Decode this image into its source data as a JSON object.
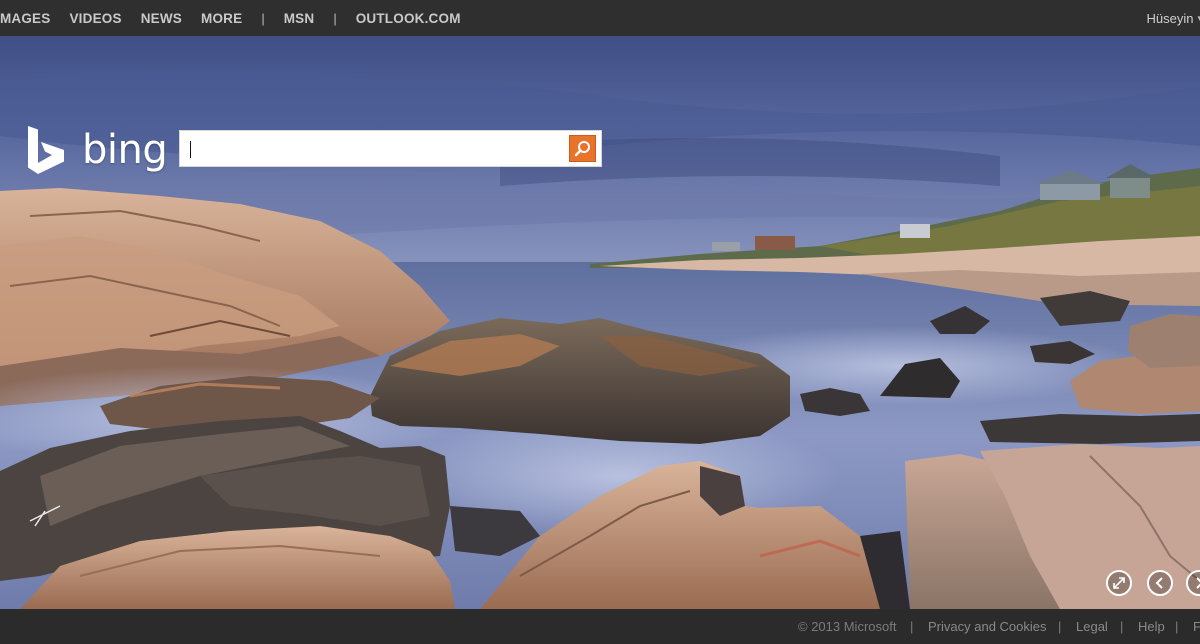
{
  "nav": {
    "items": [
      "IMAGES",
      "VIDEOS",
      "NEWS",
      "MORE"
    ],
    "separator": "|",
    "msn": "MSN",
    "outlook": "OUTLOOK.COM"
  },
  "user": {
    "name": "Hüseyin"
  },
  "logo": {
    "text": "bing"
  },
  "search": {
    "value": "",
    "placeholder": ""
  },
  "controls": [
    "fullscreen-icon",
    "previous-image-icon",
    "next-image-icon"
  ],
  "footer": {
    "copyright": "© 2013 Microsoft",
    "separator": "|",
    "privacy": "Privacy and Cookies",
    "legal": "Legal",
    "help": "Help",
    "truncated": "F"
  },
  "colors": {
    "accent": "#e8742b",
    "topbar": "#2f2f2f",
    "footer": "#2b2b2b"
  }
}
